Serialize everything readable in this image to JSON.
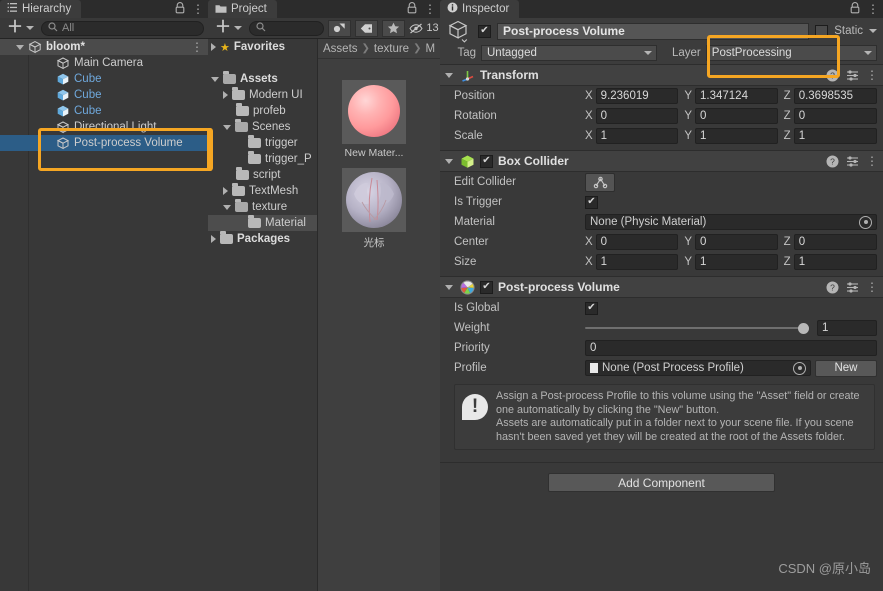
{
  "hierarchy": {
    "tab_label": "Hierarchy",
    "tab_icon": "hierarchy-icon",
    "lock_icon": "lock-icon",
    "menu_icon": "kebab-menu-icon",
    "create_label": "+",
    "search_placeholder": "All",
    "scene": {
      "name": "bloom*",
      "icon": "unity-scene-icon"
    },
    "items": [
      {
        "label": "Main Camera",
        "icon": "gameobject-icon",
        "type": "plain",
        "selected": false
      },
      {
        "label": "Cube",
        "icon": "prefab-icon",
        "type": "prefab",
        "selected": false
      },
      {
        "label": "Cube",
        "icon": "prefab-icon",
        "type": "prefab",
        "selected": false
      },
      {
        "label": "Cube",
        "icon": "prefab-icon",
        "type": "prefab",
        "selected": false
      },
      {
        "label": "Directional Light",
        "icon": "gameobject-icon",
        "type": "plain",
        "selected": false
      },
      {
        "label": "Post-process Volume",
        "icon": "gameobject-icon",
        "type": "plain",
        "selected": true
      }
    ]
  },
  "project": {
    "tab_label": "Project",
    "tab_icon": "folder-icon",
    "lock_icon": "lock-icon",
    "menu_icon": "kebab-menu-icon",
    "create_label": "+",
    "search_placeholder": "",
    "toolbar_icons": [
      "asset-filter-icon",
      "label-filter-icon",
      "favorite-star-icon"
    ],
    "hidden_count": "13",
    "breadcrumb": [
      "Assets",
      "texture",
      "M"
    ],
    "tree": [
      {
        "label": "Favorites",
        "depth": 0,
        "arrow": "right",
        "kind": "star"
      },
      {
        "label": "",
        "depth": 0,
        "arrow": "none",
        "kind": "spacer"
      },
      {
        "label": "Assets",
        "depth": 0,
        "arrow": "down",
        "kind": "folder-open"
      },
      {
        "label": "Modern UI",
        "depth": 1,
        "arrow": "right",
        "kind": "folder"
      },
      {
        "label": "profeb",
        "depth": 1,
        "arrow": "none",
        "kind": "folder"
      },
      {
        "label": "Scenes",
        "depth": 1,
        "arrow": "down",
        "kind": "folder-open"
      },
      {
        "label": "trigger",
        "depth": 2,
        "arrow": "none",
        "kind": "folder"
      },
      {
        "label": "trigger_P",
        "depth": 2,
        "arrow": "none",
        "kind": "folder"
      },
      {
        "label": "script",
        "depth": 1,
        "arrow": "none",
        "kind": "folder"
      },
      {
        "label": "TextMesh ",
        "depth": 1,
        "arrow": "right",
        "kind": "folder"
      },
      {
        "label": "texture",
        "depth": 1,
        "arrow": "down",
        "kind": "folder-open"
      },
      {
        "label": "Material",
        "depth": 2,
        "arrow": "none",
        "kind": "folder",
        "selected": true
      },
      {
        "label": "Packages",
        "depth": 0,
        "arrow": "right",
        "kind": "folder"
      }
    ],
    "assets": [
      {
        "name": "New Mater...",
        "thumb": "material-sphere-pink"
      },
      {
        "name": "光标",
        "thumb": "cursor-texture"
      }
    ]
  },
  "inspector": {
    "tab_label": "Inspector",
    "tab_icon": "info-icon",
    "lock_icon": "lock-icon",
    "menu_icon": "kebab-menu-icon",
    "object_icon": "gameobject-cube-icon",
    "enabled": true,
    "name": "Post-process Volume",
    "static_label": "Static",
    "static_checked": false,
    "tag_label": "Tag",
    "tag_value": "Untagged",
    "layer_label": "Layer",
    "layer_value": "PostProcessing",
    "components": [
      {
        "title": "Transform",
        "icon": "transform-icon",
        "has_checkbox": false,
        "help_icon": "help-icon",
        "preset_icon": "preset-icon",
        "menu_icon": "kebab-menu-icon",
        "rows": [
          {
            "type": "vec3",
            "label": "Position",
            "x": "9.236019",
            "y": "1.347124",
            "z": "0.3698535"
          },
          {
            "type": "vec3",
            "label": "Rotation",
            "x": "0",
            "y": "0",
            "z": "0"
          },
          {
            "type": "vec3",
            "label": "Scale",
            "x": "1",
            "y": "1",
            "z": "1"
          }
        ]
      },
      {
        "title": "Box Collider",
        "icon": "box-collider-icon",
        "has_checkbox": true,
        "checked": true,
        "help_icon": "help-icon",
        "preset_icon": "preset-icon",
        "menu_icon": "kebab-menu-icon",
        "rows": [
          {
            "type": "button",
            "label": "Edit Collider",
            "button_icon": "edit-collider-icon"
          },
          {
            "type": "checkbox",
            "label": "Is Trigger",
            "checked": true
          },
          {
            "type": "object",
            "label": "Material",
            "value": "None (Physic Material)"
          },
          {
            "type": "vec3",
            "label": "Center",
            "x": "0",
            "y": "0",
            "z": "0"
          },
          {
            "type": "vec3",
            "label": "Size",
            "x": "1",
            "y": "1",
            "z": "1"
          }
        ]
      },
      {
        "title": "Post-process Volume",
        "icon": "post-process-icon",
        "has_checkbox": true,
        "checked": true,
        "help_icon": "help-icon",
        "preset_icon": "preset-icon",
        "menu_icon": "kebab-menu-icon",
        "rows": [
          {
            "type": "checkbox",
            "label": "Is Global",
            "checked": true
          },
          {
            "type": "slider",
            "label": "Weight",
            "value": "1",
            "percent": 100
          },
          {
            "type": "text",
            "label": "Priority",
            "value": "0"
          },
          {
            "type": "profile",
            "label": "Profile",
            "value": "None (Post Process Profile)",
            "button": "New"
          }
        ],
        "helpbox": "Assign a Post-process Profile to this volume using the \"Asset\" field or create one automatically by clicking the \"New\" button.\nAssets are automatically put in a folder next to your scene file. If you scene hasn't been saved yet they will be created at the root of the Assets folder."
      }
    ],
    "add_component_label": "Add Component"
  },
  "watermark": "CSDN @原小岛",
  "colors": {
    "accent_highlight": "#f5a623",
    "selection_blue": "#2c5d87",
    "panel_bg": "#383838",
    "inspector_bg": "#393939"
  }
}
